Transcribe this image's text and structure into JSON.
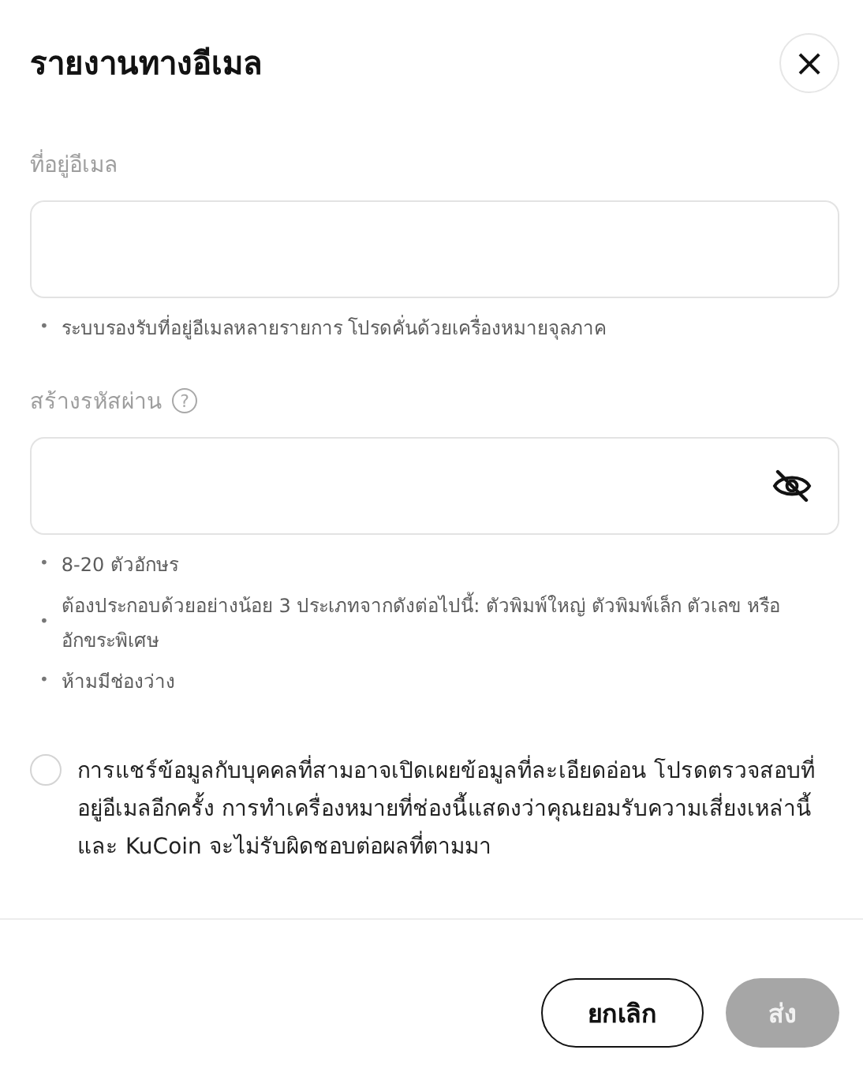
{
  "dialog": {
    "title": "รายงานทางอีเมล",
    "close_icon": "×"
  },
  "email": {
    "label": "ที่อยู่อีเมล",
    "hint_bullet": "•",
    "hints": [
      "ระบบรองรับที่อยู่อีเมลหลายรายการ โปรดคั่นด้วยเครื่องหมายจุลภาค"
    ]
  },
  "password": {
    "label": "สร้างรหัสผ่าน",
    "help_icon": "?",
    "visible": false,
    "hint_bullet": "•",
    "hints": [
      "8-20 ตัวอักษร",
      "ต้องประกอบด้วยอย่างน้อย 3 ประเภทจากดังต่อไปนี้: ตัวพิมพ์ใหญ่ ตัวพิมพ์เล็ก ตัวเลข หรืออักขระพิเศษ",
      "ห้ามมีช่องว่าง"
    ]
  },
  "consent": {
    "checked": false,
    "text": "การแชร์ข้อมูลกับบุคคลที่สามอาจเปิดเผยข้อมูลที่ละเอียดอ่อน โปรดตรวจสอบที่อยู่อีเมลอีกครั้ง การทำเครื่องหมายที่ช่องนี้แสดงว่าคุณยอมรับความเสี่ยงเหล่านี้และ KuCoin จะไม่รับผิดชอบต่อผลที่ตามมา"
  },
  "buttons": [
    {
      "kind": "secondary",
      "label": "ยกเลิก",
      "disabled": false
    },
    {
      "kind": "primary",
      "label": "ส่ง",
      "disabled": true
    }
  ]
}
